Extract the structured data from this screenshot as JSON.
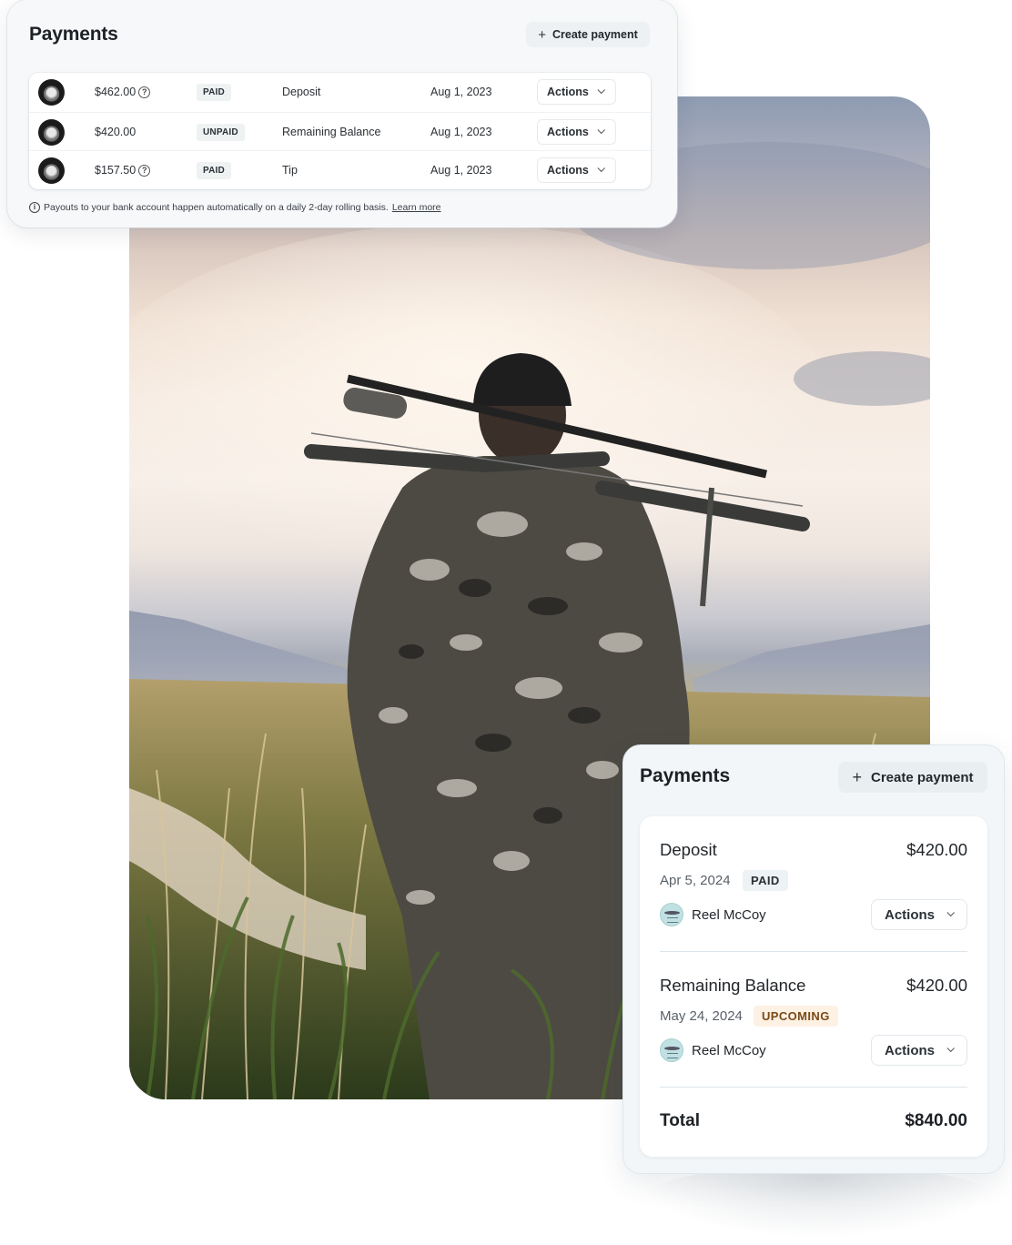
{
  "colors": {
    "paid_badge_bg": "#eef2f3",
    "upcoming_badge_bg": "#fdf1e4",
    "upcoming_badge_text": "#7a4a17",
    "card_bg": "#f7f8fa",
    "button_bg": "#edf1f3"
  },
  "top_card": {
    "title": "Payments",
    "create_button": {
      "icon": "plus-icon",
      "label": "Create payment"
    },
    "rows": [
      {
        "avatar": "user-avatar",
        "amount": "$462.00",
        "has_help_icon": true,
        "status": "PAID",
        "description": "Deposit",
        "date": "Aug 1, 2023",
        "actions_label": "Actions"
      },
      {
        "avatar": "user-avatar",
        "amount": "$420.00",
        "has_help_icon": false,
        "status": "UNPAID",
        "description": "Remaining Balance",
        "date": "Aug 1, 2023",
        "actions_label": "Actions"
      },
      {
        "avatar": "user-avatar",
        "amount": "$157.50",
        "has_help_icon": true,
        "status": "PAID",
        "description": "Tip",
        "date": "Aug 1, 2023",
        "actions_label": "Actions"
      }
    ],
    "footnote": {
      "icon": "info-icon",
      "text": "Payouts to your bank account happen automatically on a daily 2-day rolling basis.",
      "link": "Learn more"
    }
  },
  "photo": {
    "description": "Bowhunter in camouflage carrying a compound bow across shoulders, standing in tall grass at sunset"
  },
  "bottom_card": {
    "title": "Payments",
    "create_button": {
      "icon": "plus-icon",
      "label": "Create payment"
    },
    "items": [
      {
        "name": "Deposit",
        "amount": "$420.00",
        "date": "Apr 5, 2024",
        "status": "PAID",
        "payer": "Reel McCoy",
        "actions_label": "Actions"
      },
      {
        "name": "Remaining Balance",
        "amount": "$420.00",
        "date": "May 24, 2024",
        "status": "UPCOMING",
        "payer": "Reel McCoy",
        "actions_label": "Actions"
      }
    ],
    "total_label": "Total",
    "total_amount": "$840.00"
  }
}
